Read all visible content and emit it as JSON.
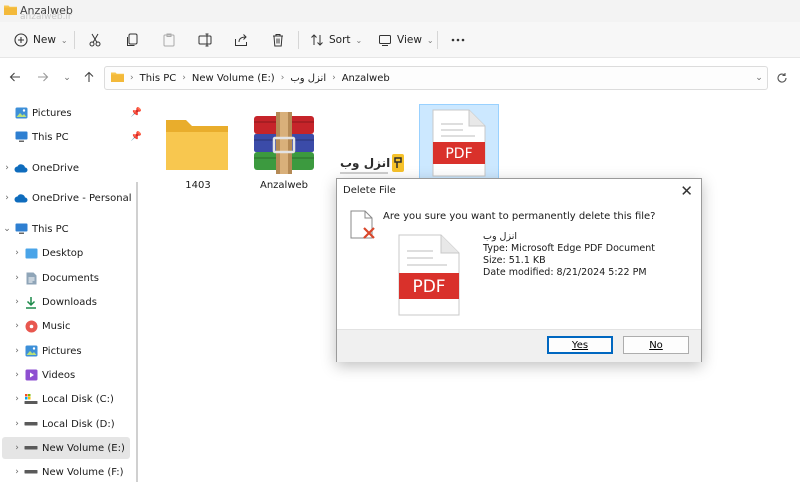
{
  "window": {
    "title": "Anzalweb",
    "watermark": "anzalweb.ir"
  },
  "toolbar": {
    "new_label": "New",
    "sort_label": "Sort",
    "view_label": "View"
  },
  "address": {
    "crumbs": [
      "This PC",
      "New Volume (E:)",
      "انزل وب",
      "Anzalweb"
    ]
  },
  "sidebar": {
    "items": [
      {
        "label": "Pictures",
        "pinned": true
      },
      {
        "label": "This PC",
        "pinned": true
      },
      {
        "label": "OneDrive"
      },
      {
        "label": "OneDrive - Personal"
      },
      {
        "label": "This PC"
      },
      {
        "label": "Desktop"
      },
      {
        "label": "Documents"
      },
      {
        "label": "Downloads"
      },
      {
        "label": "Music"
      },
      {
        "label": "Pictures"
      },
      {
        "label": "Videos"
      },
      {
        "label": "Local Disk (C:)"
      },
      {
        "label": "Local Disk (D:)"
      },
      {
        "label": "New Volume (E:)",
        "selected": true
      },
      {
        "label": "New Volume (F:)"
      }
    ]
  },
  "files": [
    {
      "name": "1403",
      "type": "folder-icon"
    },
    {
      "name": "Anzalweb",
      "type": "winrar-archive-icon"
    },
    {
      "name": "",
      "type": "anzalweb-logo",
      "logo_text": "انزل وب"
    },
    {
      "name": "",
      "type": "pdf-file-icon",
      "selected": true
    }
  ],
  "dialog": {
    "title": "Delete File",
    "close_glyph": "✕",
    "question": "Are you sure you want to permanently delete this file?",
    "file_name": "انزل وب",
    "file_type": "Type: Microsoft Edge PDF Document",
    "file_size": "Size: 51.1 KB",
    "file_modified": "Date modified: 8/21/2024 5:22 PM",
    "yes_label": "Yes",
    "no_label": "No"
  },
  "colors": {
    "accent": "#0067c0",
    "selection": "#cce8ff",
    "pdf_red": "#d9312b",
    "folder": "#f8c74f"
  }
}
